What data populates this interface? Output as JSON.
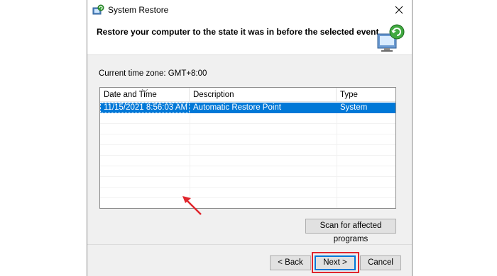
{
  "window": {
    "title": "System Restore",
    "heading": "Restore your computer to the state it was in before the selected event"
  },
  "timezone_label": "Current time zone: GMT+8:00",
  "table": {
    "columns": [
      "Date and Time",
      "Description",
      "Type"
    ],
    "rows": [
      {
        "date": "11/15/2021 8:56:03 AM",
        "description": "Automatic Restore Point",
        "type": "System",
        "selected": true
      }
    ]
  },
  "buttons": {
    "scan": "Scan for affected programs",
    "back": "< Back",
    "next": "Next >",
    "cancel": "Cancel"
  },
  "colors": {
    "selection": "#0078d7",
    "annotation": "#e0262d"
  },
  "icons": {
    "app": "system-restore-icon",
    "close": "close-icon",
    "header": "computer-restore-icon",
    "sort": "sort-chevron-icon"
  }
}
